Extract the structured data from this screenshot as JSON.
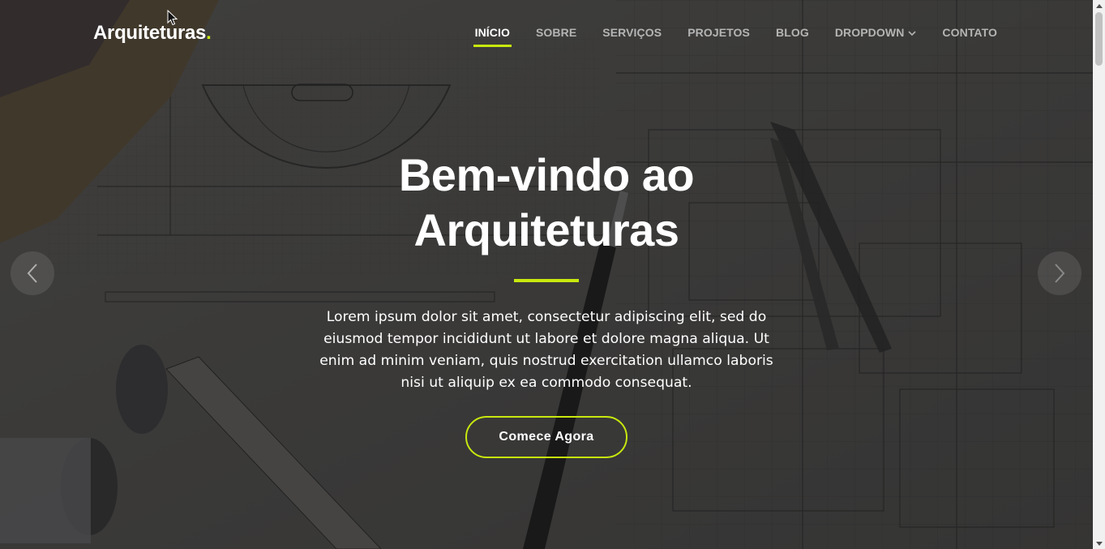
{
  "brand": {
    "name": "Arquiteturas",
    "dot": ".",
    "accent_color": "#c8e80e"
  },
  "nav": {
    "items": [
      {
        "label": "INÍCIO",
        "active": true
      },
      {
        "label": "SOBRE"
      },
      {
        "label": "SERVIÇOS"
      },
      {
        "label": "PROJETOS"
      },
      {
        "label": "BLOG"
      },
      {
        "label": "DROPDOWN",
        "icon": "chevron-down-icon"
      },
      {
        "label": "CONTATO"
      }
    ]
  },
  "hero": {
    "title_line1": "Bem-vindo ao",
    "title_line2": "Arquiteturas",
    "description": "Lorem ipsum dolor sit amet, consectetur adipiscing elit, sed do eiusmod tempor incididunt ut labore et dolore magna aliqua. Ut enim ad minim veniam, quis nostrud exercitation ullamco laboris nisi ut aliquip ex ea commodo consequat.",
    "cta_label": "Comece Agora",
    "background": "architectural-blueprint-photo"
  },
  "carousel": {
    "prev_icon": "chevron-left-icon",
    "next_icon": "chevron-right-icon"
  },
  "scrollbar": {
    "up_icon": "scroll-up-arrow-icon",
    "down_icon": "scroll-down-arrow-icon"
  }
}
